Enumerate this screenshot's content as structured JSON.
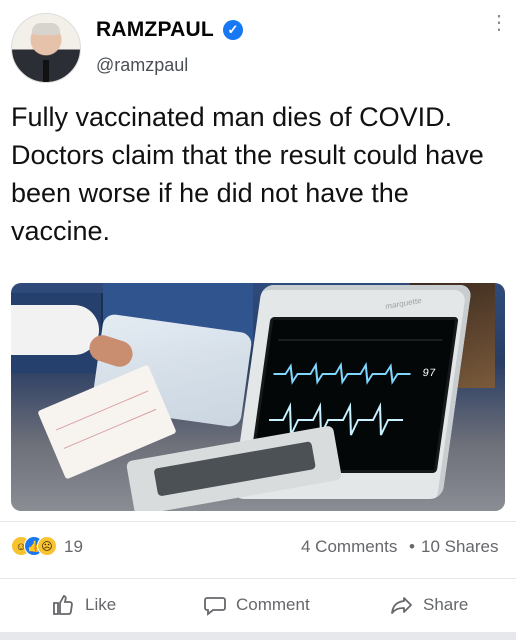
{
  "post": {
    "author_name": "RAMZPAUL",
    "handle": "@ramzpaul",
    "text": "Fully vaccinated man dies of COVID. Doctors claim that the result could have been worse if he did not have the vaccine.",
    "image_overlay": {
      "monitor_brand": "marquette",
      "heart_rate": "97"
    }
  },
  "reactions": {
    "count": "19",
    "icons": [
      "laugh-react-icon",
      "like-react-icon",
      "sad-react-icon"
    ]
  },
  "engagement": {
    "comments": "4 Comments",
    "separator": "•",
    "shares": "10 Shares"
  },
  "actions": {
    "like": "Like",
    "comment": "Comment",
    "share": "Share"
  },
  "colors": {
    "verified": "#1877f2",
    "muted_text": "#65676b",
    "divider": "#e4e6eb"
  }
}
